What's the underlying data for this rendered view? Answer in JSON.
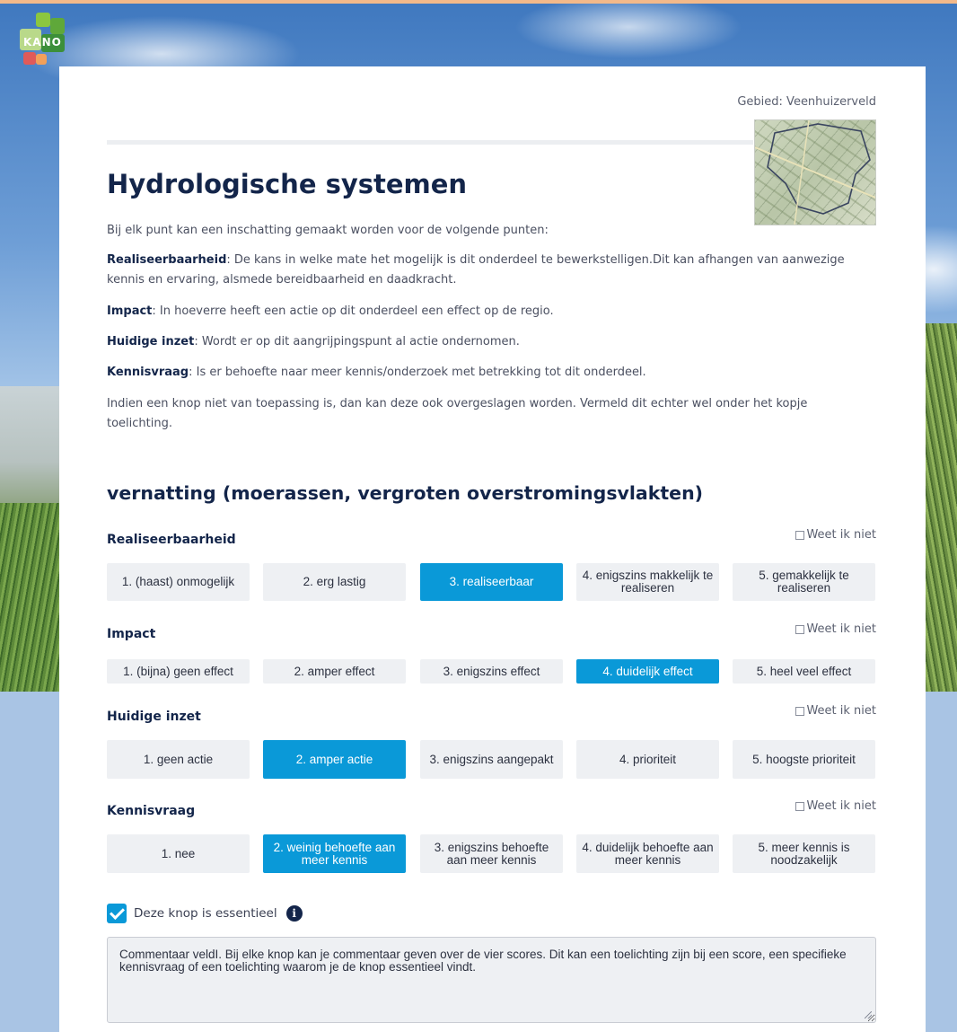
{
  "logo": {
    "text": "KANO"
  },
  "header": {
    "region": "Gebied: Veenhuizerveld"
  },
  "page": {
    "title": "Hydrologische systemen",
    "intro": "Bij elk punt kan een inschatting gemaakt worden voor de volgende punten:",
    "definitions": [
      {
        "term": "Realiseerbaarheid",
        "text": ": De kans in welke mate het mogelijk is dit onderdeel te bewerkstelligen.Dit kan afhangen van aanwezige kennis en ervaring, alsmede bereidbaarheid en daadkracht."
      },
      {
        "term": "Impact",
        "text": ": In hoeverre heeft een actie op dit onderdeel een effect op de regio."
      },
      {
        "term": "Huidige inzet",
        "text": ": Wordt er op dit aangrijpingspunt al actie ondernomen."
      },
      {
        "term": "Kennisvraag",
        "text": ": Is er behoefte naar meer kennis/onderzoek met betrekking tot dit onderdeel."
      }
    ],
    "note": "Indien een knop niet van toepassing is, dan kan deze ook overgeslagen worden. Vermeld dit echter wel onder het kopje toelichting."
  },
  "section": {
    "title": "vernatting (moerassen, vergroten overstromingsvlakten)",
    "dont_know_label": "Weet ik niet",
    "criteria": [
      {
        "label": "Realiseerbaarheid",
        "options": [
          "1. (haast) onmogelijk",
          "2. erg lastig",
          "3. realiseerbaar",
          "4. enigszins makkelijk te realiseren",
          "5. gemakkelijk te realiseren"
        ],
        "selected": 3
      },
      {
        "label": "Impact",
        "options": [
          "1. (bijna) geen effect",
          "2. amper effect",
          "3. enigszins effect",
          "4. duidelijk effect",
          "5. heel veel effect"
        ],
        "selected": 4
      },
      {
        "label": "Huidige inzet",
        "options": [
          "1. geen actie",
          "2. amper actie",
          "3. enigszins aangepakt",
          "4. prioriteit",
          "5. hoogste prioriteit"
        ],
        "selected": 2
      },
      {
        "label": "Kennisvraag",
        "options": [
          "1. nee",
          "2. weinig behoefte aan meer kennis",
          "3. enigszins behoefte aan meer kennis",
          "4. duidelijk behoefte aan meer kennis",
          "5. meer kennis is noodzakelijk"
        ],
        "selected": 2
      }
    ],
    "essential_label": "Deze knop is essentieel",
    "essential_checked": true,
    "info_icon": "i",
    "comment": "Commentaar veldI. Bij elke knop kan je commentaar geven over de vier scores. Dit kan een toelichting zijn bij een score, een specifieke kennisvraag of een toelichting waarom je de knop essentieel vindt."
  },
  "colors": {
    "accent": "#0a99d8",
    "heading": "#13254a",
    "option_bg": "#eef0f3"
  }
}
